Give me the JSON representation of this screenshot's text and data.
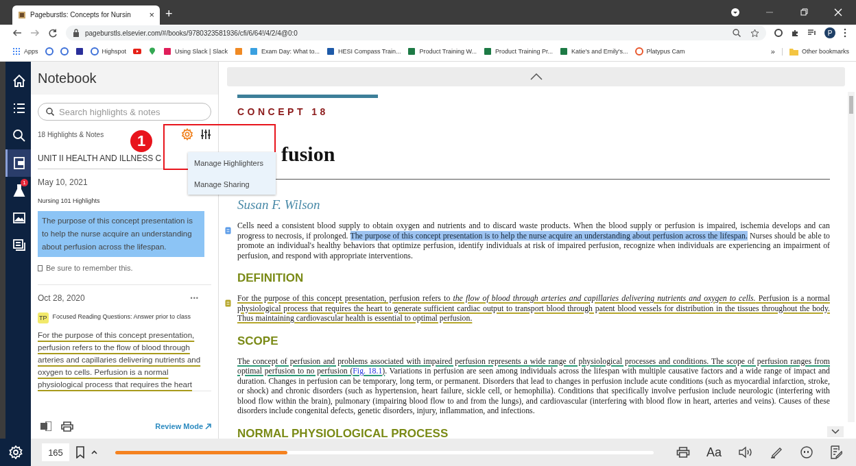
{
  "browser": {
    "tab_title": "Pageburstls: Concepts for Nursin",
    "tab_close": "×",
    "new_tab": "+",
    "url": "pageburstls.elsevier.com/#/books/9780323581936/cfi/6/64!/4/2/4@0:0",
    "bookmarks": [
      {
        "kind": "apps",
        "label": "Apps",
        "color": "#4285f4"
      },
      {
        "kind": "circle",
        "color": "#3b6fd8"
      },
      {
        "kind": "circle",
        "color": "#3b6fd8"
      },
      {
        "kind": "square",
        "color": "#2a2f9a"
      },
      {
        "kind": "circle",
        "label": "Highspot",
        "color": "#3b6fd8"
      },
      {
        "kind": "play",
        "color": "#e62117"
      },
      {
        "kind": "pin",
        "color": "#34a853"
      },
      {
        "kind": "square",
        "label": "Using Slack | Slack",
        "color": "#e01e5a"
      },
      {
        "kind": "square",
        "color": "#f08a24"
      },
      {
        "kind": "square",
        "label": "Exam Day: What to...",
        "color": "#3aa0e0"
      },
      {
        "kind": "square",
        "label": "HESI Compass Train...",
        "color": "#1e5aa8"
      },
      {
        "kind": "square",
        "label": "Product Training W...",
        "color": "#1d7a45"
      },
      {
        "kind": "square",
        "label": "Product Training Pr...",
        "color": "#1d7a45"
      },
      {
        "kind": "square",
        "label": "Katie's and Emily's...",
        "color": "#1d7a45"
      },
      {
        "kind": "circle",
        "label": "Platypus Cam",
        "color": "#e8552a"
      }
    ],
    "more": "»",
    "other_bookmarks": "Other bookmarks",
    "profile": "P"
  },
  "rail": [
    {
      "kind": "home",
      "selected": false
    },
    {
      "kind": "list",
      "selected": false
    },
    {
      "kind": "search",
      "selected": false
    },
    {
      "kind": "notebook",
      "selected": true
    },
    {
      "kind": "flask",
      "selected": false,
      "badge": "1"
    },
    {
      "kind": "image",
      "selected": false
    },
    {
      "kind": "notes",
      "selected": false
    }
  ],
  "notebook": {
    "title": "Notebook",
    "search": {
      "placeholder": "Search highlights & notes"
    },
    "count": "18 Highlights & Notes",
    "callout": "1",
    "menu": [
      "Manage Highlighters",
      "Manage Sharing"
    ],
    "unit": "UNIT II HEALTH AND ILLNESS C",
    "notes": [
      {
        "date": "May 10, 2021",
        "label": "Nursing 101 Highlights",
        "kind": "highlight",
        "color": "#8cc4f5",
        "text": "The purpose of this concept presentation is to help the nurse acquire an understanding about perfusion across the lifespan.",
        "comment": "Be sure to remember this."
      },
      {
        "date": "Oct 28, 2020",
        "more": "•••",
        "tag": "TP",
        "label": "Focused Reading Questions: Answer prior to class",
        "kind": "underline",
        "color": "#a89a1c",
        "text": "For the purpose of this concept presentation, perfusion refers to the flow of blood through arteries and capillaries delivering nutrients and oxygen to cells. Perfusion is a normal physiological process that requires the heart"
      }
    ],
    "review_mode": "Review Mode"
  },
  "reader": {
    "concept": "CONCEPT 18",
    "title": "fusion",
    "author": "Susan F. Wilson",
    "blocks": [
      {
        "kind": "paragraph",
        "marker": true,
        "color": "#5b9be8",
        "segments": [
          {
            "kind": "plain",
            "text": "Cells need a consistent blood supply to obtain oxygen and nutrients and to discard waste products. When the blood supply or perfusion is impaired, ischemia develops and can progress to necrosis, if prolonged. "
          },
          {
            "kind": "highlight",
            "text": "The purpose of this concept presentation is to help the nurse acquire an understanding about perfusion across the lifespan."
          },
          {
            "kind": "plain",
            "text": " Nurses should be able to promote an individual's healthy behaviors that optimize perfusion, identify individuals at risk of impaired perfusion, recognize when individuals are experiencing an impairment of perfusion, and respond with appropriate interventions."
          }
        ]
      },
      {
        "kind": "heading",
        "text": "DEFINITION"
      },
      {
        "kind": "paragraph",
        "marker": true,
        "color": "#b5a62a",
        "segments": [
          {
            "kind": "underline",
            "text": "For the purpose of this concept presentation, perfusion refers to "
          },
          {
            "kind": "underline-italic",
            "text": "the flow of blood through arteries and capillaries delivering nutrients and oxygen to cells."
          },
          {
            "kind": "underline",
            "text": " Perfusion is a normal physiological process that requires the heart to generate sufficient cardiac output to transport blood through patent blood vessels for distribution in the tissues throughout the body. Thus maintaining cardiovascular health is essential to optimal perfusion."
          }
        ]
      },
      {
        "kind": "heading",
        "text": "SCOPE"
      },
      {
        "kind": "paragraph",
        "marker": false,
        "color": "#2a9a78",
        "segments": [
          {
            "kind": "underline",
            "text": "The concept of perfusion and problems associated with impaired perfusion represents a wide range of physiological processes and conditions. The scope of perfusion ranges from optimal perfusion to no perfusion ("
          },
          {
            "kind": "link",
            "text": "Fig. 18.1"
          },
          {
            "kind": "underline",
            "text": ")"
          },
          {
            "kind": "plain",
            "text": ". Variations in perfusion are seen among individuals across the lifespan with multiple causative factors and a wide range of impact and duration. Changes in perfusion can be temporary, long term, or permanent. Disorders that lead to changes in perfusion include acute conditions (such as myocardial infarction, stroke, or shock) and chronic disorders (such as hypertension, heart failure, sickle cell, or hemophilia). Conditions that specifically involve perfusion include neurologic (interfering with blood flow within the brain), pulmonary (impairing blood flow to and from the lungs), and cardiovascular (interfering with blood flow in heart, arteries and veins). Causes of these disorders include congenital defects, genetic disorders, injury, inflammation, and infections."
          }
        ]
      },
      {
        "kind": "heading",
        "text": "NORMAL PHYSIOLOGICAL PROCESS"
      }
    ]
  },
  "bottom_bar": {
    "page": "165",
    "progress": {
      "level": 0.32
    },
    "text_size": "Aa"
  }
}
